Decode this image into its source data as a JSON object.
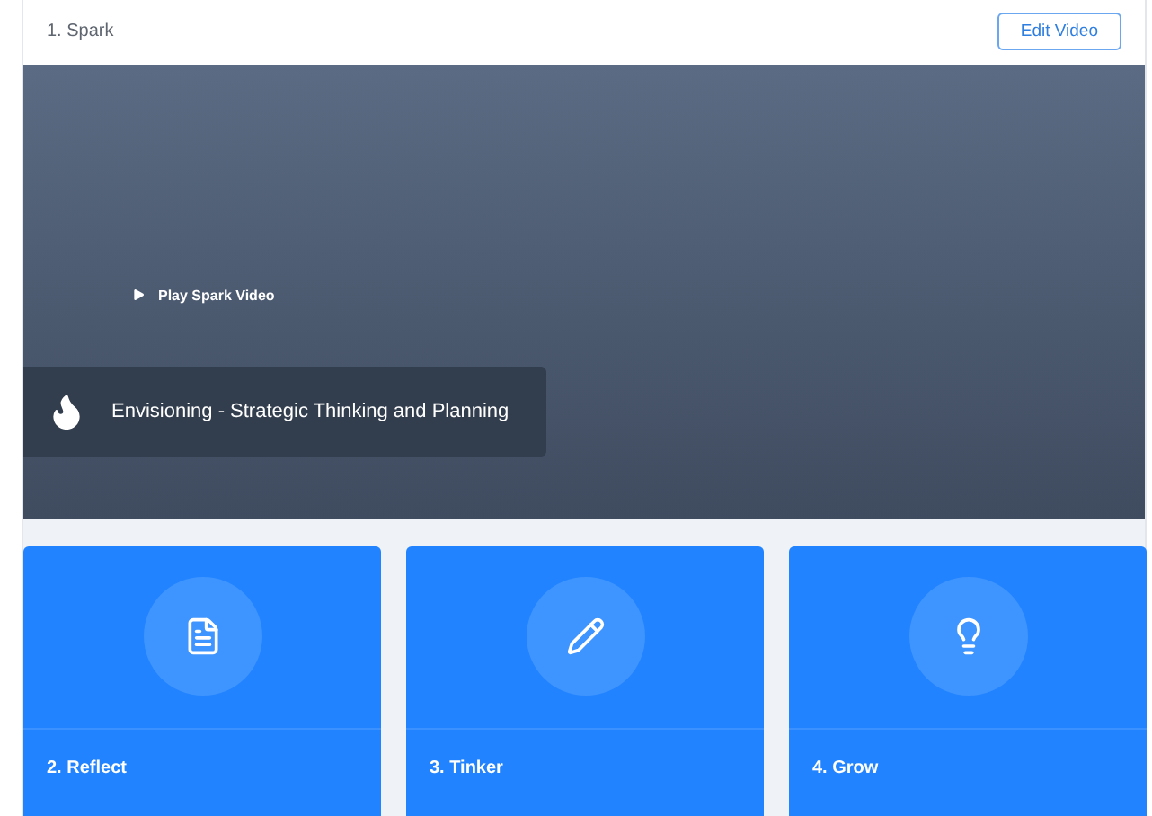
{
  "header": {
    "title": "1. Spark",
    "button": "Edit Video"
  },
  "video": {
    "play_label": "Play Spark Video",
    "banner": "Envisioning - Strategic Thinking and Planning"
  },
  "cards": [
    {
      "label": "2. Reflect",
      "kind": "reflect"
    },
    {
      "label": "3. Tinker",
      "kind": "tinker"
    },
    {
      "label": "4. Grow",
      "kind": "grow"
    }
  ]
}
